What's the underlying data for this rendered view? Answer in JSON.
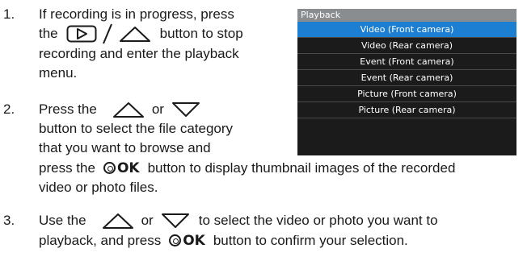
{
  "steps": [
    {
      "number": "1.",
      "lines": [
        "If recording is in progress, press",
        "the",
        "button to stop",
        "recording and enter the playback",
        "menu."
      ]
    },
    {
      "number": "2.",
      "lines": [
        "Press the",
        "or",
        "button to select the file category",
        "that you want to browse and",
        "press the",
        "button to display thumbnail images of the recorded",
        "video or photo files."
      ]
    },
    {
      "number": "3.",
      "lines": [
        "Use the",
        "or",
        "to select the video or photo you want to",
        "playback, and press",
        "button to confirm your selection."
      ]
    }
  ],
  "ok_label": "OK",
  "menu": {
    "title": "Playback",
    "items": [
      "Video (Front camera)",
      "Video (Rear camera)",
      "Event (Front camera)",
      "Event (Rear camera)",
      "Picture (Front camera)",
      "Picture (Rear camera)"
    ],
    "selected_index": 0,
    "colors": {
      "title_bar": "#8a8d8f",
      "background": "#1b1b1b",
      "selected": "#1d7fd1"
    }
  }
}
